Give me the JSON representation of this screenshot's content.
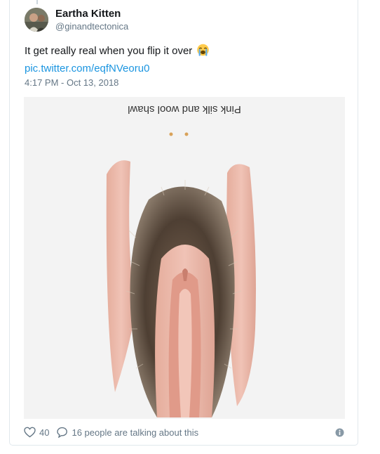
{
  "author": {
    "name": "Eartha Kitten",
    "handle": "@ginandtectonica",
    "avatar_icon": "user-avatar"
  },
  "tweet": {
    "text": "It get really real when you flip it over",
    "emoji": "loudly-crying-face-emoji",
    "link": "pic.twitter.com/eqfNVeoru0",
    "timestamp": "4:17 PM - Oct 13, 2018"
  },
  "media": {
    "caption_upside_down": "Pink silk and wool shawl",
    "background_color": "#f3f3f3",
    "fur_color": "#5b4a3a",
    "silk_color": "#e8b5a6"
  },
  "actions": {
    "like_icon": "heart-icon",
    "like_count": "40",
    "reply_icon": "speech-bubble-icon",
    "talking_text": "16 people are talking about this",
    "info_icon": "info-icon"
  },
  "colors": {
    "link": "#1b95e0",
    "secondary_text": "#657786",
    "border": "#e1e8ed"
  }
}
